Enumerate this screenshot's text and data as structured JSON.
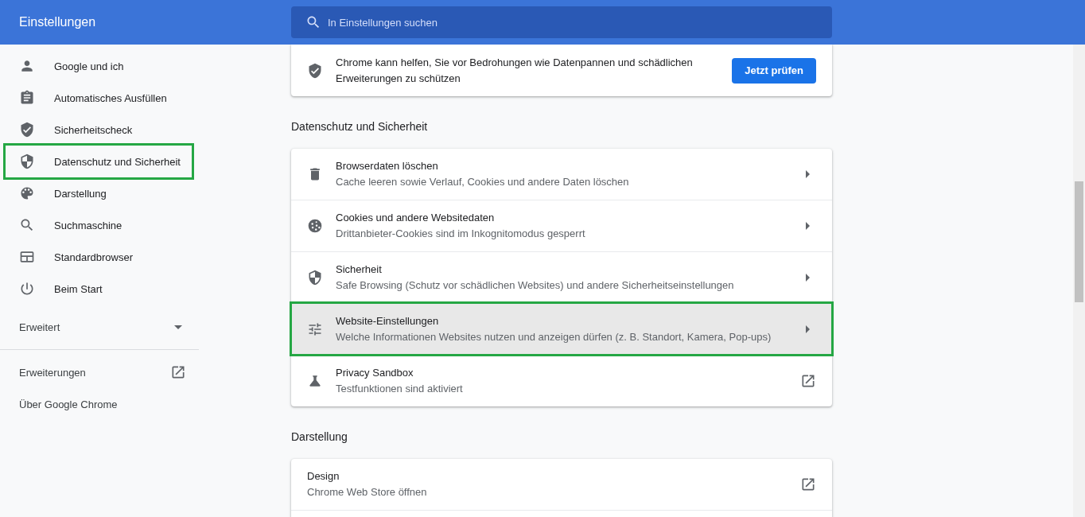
{
  "header": {
    "title": "Einstellungen",
    "search": {
      "placeholder": "In Einstellungen suchen"
    }
  },
  "sidebar": {
    "items": [
      {
        "label": "Google und ich",
        "highlighted": false
      },
      {
        "label": "Automatisches Ausfüllen",
        "highlighted": false
      },
      {
        "label": "Sicherheitscheck",
        "highlighted": false
      },
      {
        "label": "Datenschutz und Sicherheit",
        "highlighted": true
      },
      {
        "label": "Darstellung",
        "highlighted": false
      },
      {
        "label": "Suchmaschine",
        "highlighted": false
      },
      {
        "label": "Standardbrowser",
        "highlighted": false
      },
      {
        "label": "Beim Start",
        "highlighted": false
      }
    ],
    "advanced": {
      "label": "Erweitert",
      "expanded": false
    },
    "links": [
      {
        "label": "Erweiterungen",
        "kind": "external"
      },
      {
        "label": "Über Google Chrome",
        "kind": "plain"
      }
    ]
  },
  "safety_card": {
    "text": "Chrome kann helfen, Sie vor Bedrohungen wie Datenpannen und schädlichen Erweiterungen zu schützen",
    "button": "Jetzt prüfen"
  },
  "sections": [
    {
      "title": "Datenschutz und Sicherheit",
      "rows": [
        {
          "title": "Browserdaten löschen",
          "subtitle": "Cache leeren sowie Verlauf, Cookies und andere Daten löschen",
          "kind": "arrow",
          "highlighted": false
        },
        {
          "title": "Cookies und andere Websitedaten",
          "subtitle": "Drittanbieter-Cookies sind im Inkognitomodus gesperrt",
          "kind": "arrow",
          "highlighted": false
        },
        {
          "title": "Sicherheit",
          "subtitle": "Safe Browsing (Schutz vor schädlichen Websites) und andere Sicherheitseinstellungen",
          "kind": "arrow",
          "highlighted": false
        },
        {
          "title": "Website-Einstellungen",
          "subtitle": "Welche Informationen Websites nutzen und anzeigen dürfen (z. B. Standort, Kamera, Pop-ups)",
          "kind": "arrow",
          "highlighted": true
        },
        {
          "title": "Privacy Sandbox",
          "subtitle": "Testfunktionen sind aktiviert",
          "kind": "external",
          "highlighted": false
        }
      ]
    },
    {
      "title": "Darstellung",
      "rows": [
        {
          "title": "Design",
          "subtitle": "Chrome Web Store öffnen",
          "kind": "external",
          "highlighted": false
        }
      ]
    }
  ]
}
